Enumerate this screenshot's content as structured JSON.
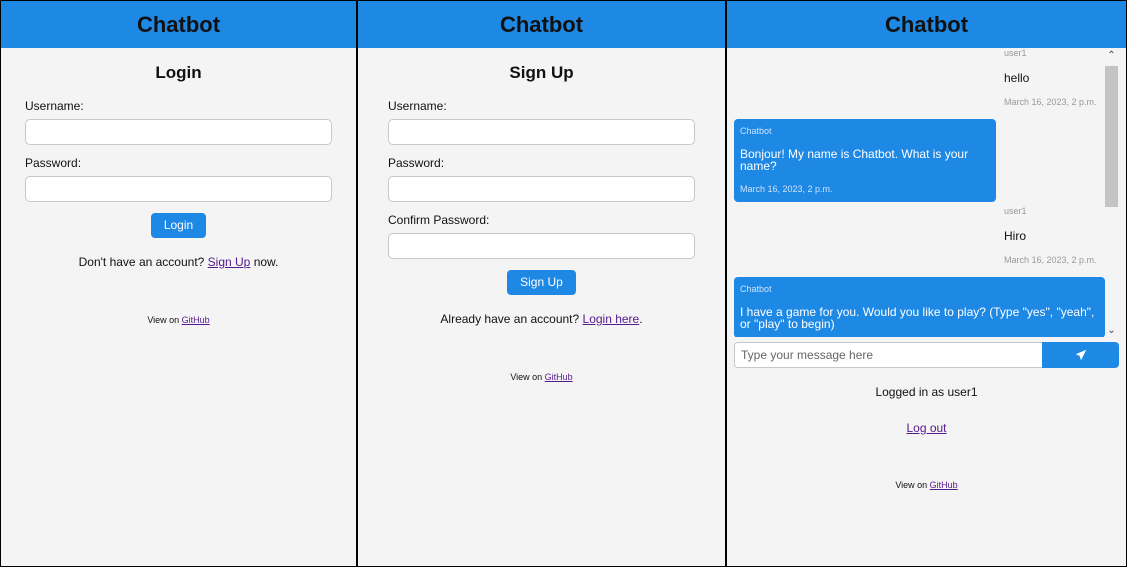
{
  "app_title": "Chatbot",
  "login": {
    "title": "Login",
    "username_label": "Username:",
    "password_label": "Password:",
    "submit_label": "Login",
    "alt_prefix": "Don't have an account? ",
    "alt_link": "Sign Up",
    "alt_suffix": " now.",
    "footer_prefix": "View on ",
    "footer_link": "GitHub"
  },
  "signup": {
    "title": "Sign Up",
    "username_label": "Username:",
    "password_label": "Password:",
    "confirm_label": "Confirm Password:",
    "submit_label": "Sign Up",
    "alt_prefix": "Already have an account? ",
    "alt_link": "Login here",
    "alt_suffix": ".",
    "footer_prefix": "View on ",
    "footer_link": "GitHub"
  },
  "chat": {
    "messages": [
      {
        "sender": "user1",
        "text": "hello",
        "time": "March 16, 2023, 2 p.m."
      },
      {
        "sender": "Chatbot",
        "text": "Bonjour! My name is Chatbot. What is your name?",
        "time": "March 16, 2023, 2 p.m."
      },
      {
        "sender": "user1",
        "text": "Hiro",
        "time": "March 16, 2023, 2 p.m."
      },
      {
        "sender": "Chatbot",
        "text": "I have a game for you. Would you like to play? (Type \"yes\", \"yeah\", or \"play\" to begin)"
      }
    ],
    "input_placeholder": "Type your message here",
    "send_icon": "paper-plane-icon",
    "logged_in_text": "Logged in as user1",
    "logout_label": "Log out",
    "footer_prefix": "View on ",
    "footer_link": "GitHub"
  },
  "colors": {
    "accent": "#1e88e5",
    "background": "#f4f4f4",
    "link": "#551a8b"
  }
}
